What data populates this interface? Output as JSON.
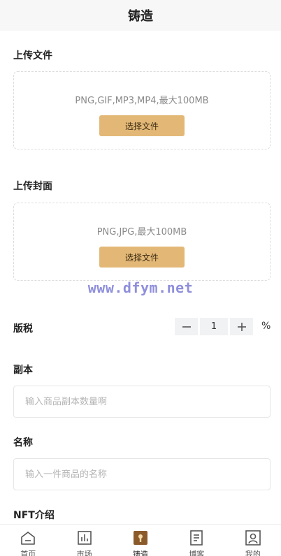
{
  "header": {
    "title": "铸造"
  },
  "upload_file": {
    "label": "上传文件",
    "hint": "PNG,GIF,MP3,MP4,最大100MB",
    "button": "选择文件"
  },
  "upload_cover": {
    "label": "上传封面",
    "hint": "PNG,JPG,最大100MB",
    "button": "选择文件"
  },
  "watermark": "www.dfym.net",
  "royalty": {
    "label": "版税",
    "minus": "−",
    "value": "1",
    "plus": "+",
    "unit": "%"
  },
  "copies": {
    "label": "副本",
    "placeholder": "输入商品副本数量啊"
  },
  "name": {
    "label": "名称",
    "placeholder": "输入一件商品的名称"
  },
  "intro": {
    "label": "NFT介绍"
  },
  "tabbar": {
    "items": [
      {
        "label": "首页",
        "icon": "home-icon"
      },
      {
        "label": "市场",
        "icon": "chart-icon"
      },
      {
        "label": "铸造",
        "icon": "mint-icon",
        "active": true
      },
      {
        "label": "博客",
        "icon": "document-icon"
      },
      {
        "label": "我的",
        "icon": "profile-icon"
      }
    ]
  }
}
